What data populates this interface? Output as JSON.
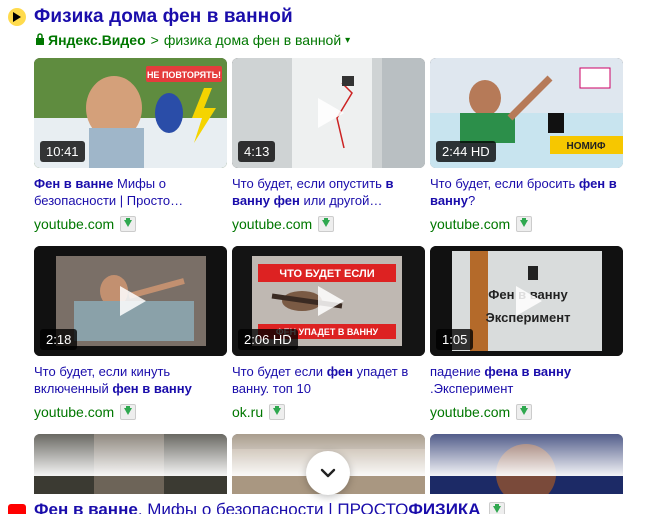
{
  "header": {
    "title": "Физика дома фен в ванной",
    "source": "Яндекс.Видео",
    "separator": ">",
    "crumb": "физика дома фен в ванной",
    "crumb_arrow": "▾"
  },
  "videos": [
    {
      "duration": "10:41",
      "desc_pre": "",
      "desc_bold": "Фен в ванне",
      "desc_post": "  Мифы о безопасности | Просто…",
      "source": "youtube.com",
      "overlay": "НЕ ПОВТОРЯТЬ!"
    },
    {
      "duration": "4:13",
      "desc_pre": "Что будет, если опустить ",
      "desc_bold": "в ванну фен",
      "desc_post": " или другой…",
      "source": "youtube.com"
    },
    {
      "duration": "2:44 HD",
      "desc_pre": "Что будет, если бросить ",
      "desc_bold": "фен в ванну",
      "desc_post": "?",
      "source": "youtube.com",
      "overlay": "НОМИФ"
    },
    {
      "duration": "2:18",
      "desc_pre": "Что будет, если кинуть включенный ",
      "desc_bold": "фен в ванну",
      "desc_post": "",
      "source": "youtube.com"
    },
    {
      "duration": "2:06 HD",
      "desc_pre": "Что будет если ",
      "desc_bold": "фен",
      "desc_post": " упадет в ванну. топ 10",
      "source": "ok.ru",
      "overlay": "ЧТО БУДЕТ ЕСЛИ",
      "overlay2": "ФЕН УПАДЕТ В ВАННУ"
    },
    {
      "duration": "1:05",
      "desc_pre": "падение ",
      "desc_bold": "фена в ванну",
      "desc_post": " .Эксперимент",
      "source": "youtube.com",
      "overlay": "Фен в ванну",
      "overlay2": "Эксперимент"
    }
  ],
  "bottom": {
    "text_bold": "Фен в ванне",
    "text_rest": ". Мифы о безопасности | ПРОСТО ",
    "text_bold2": "ФИЗИКА"
  },
  "icons": [
    "play-icon",
    "lock-icon",
    "download-icon",
    "chevron-down-icon",
    "youtube-icon"
  ]
}
